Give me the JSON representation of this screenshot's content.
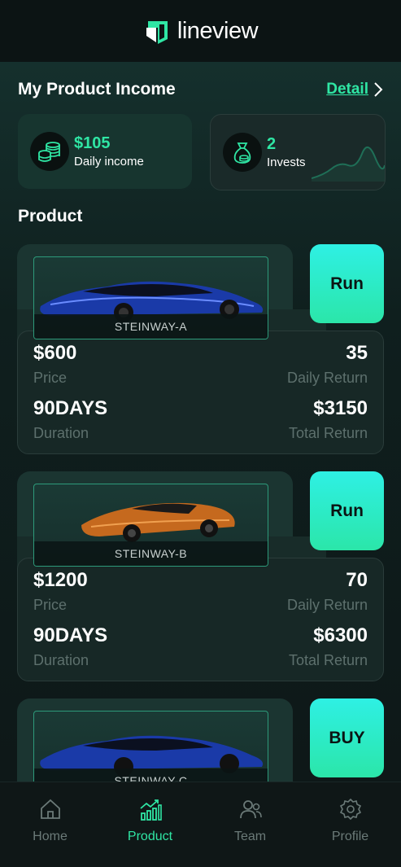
{
  "app": {
    "logo_text": "lineview"
  },
  "income": {
    "title": "My Product Income",
    "detail_label": "Detail",
    "daily": {
      "value": "$105",
      "label": "Daily income"
    },
    "invests": {
      "value": "2",
      "label": "Invests"
    }
  },
  "products": {
    "title": "Product",
    "items": [
      {
        "name": "STEINWAY-A",
        "action": "Run",
        "price": "$600",
        "price_label": "Price",
        "daily_return": "35",
        "daily_return_label": "Daily Return",
        "duration": "90DAYS",
        "duration_label": "Duration",
        "total_return": "$3150",
        "total_return_label": "Total Return",
        "car_color": "blue"
      },
      {
        "name": "STEINWAY-B",
        "action": "Run",
        "price": "$1200",
        "price_label": "Price",
        "daily_return": "70",
        "daily_return_label": "Daily Return",
        "duration": "90DAYS",
        "duration_label": "Duration",
        "total_return": "$6300",
        "total_return_label": "Total Return",
        "car_color": "orange"
      },
      {
        "name": "STEINWAY-C",
        "action": "BUY",
        "car_color": "blue"
      }
    ]
  },
  "nav": {
    "items": [
      {
        "label": "Home",
        "icon": "home-icon",
        "active": false
      },
      {
        "label": "Product",
        "icon": "bar-chart-icon",
        "active": true
      },
      {
        "label": "Team",
        "icon": "team-icon",
        "active": false
      },
      {
        "label": "Profile",
        "icon": "gear-icon",
        "active": false
      }
    ]
  },
  "colors": {
    "accent": "#2fe6a4",
    "button_top": "#2ef0e4",
    "button_bottom": "#2be6a9",
    "background": "#0f1a1a"
  }
}
